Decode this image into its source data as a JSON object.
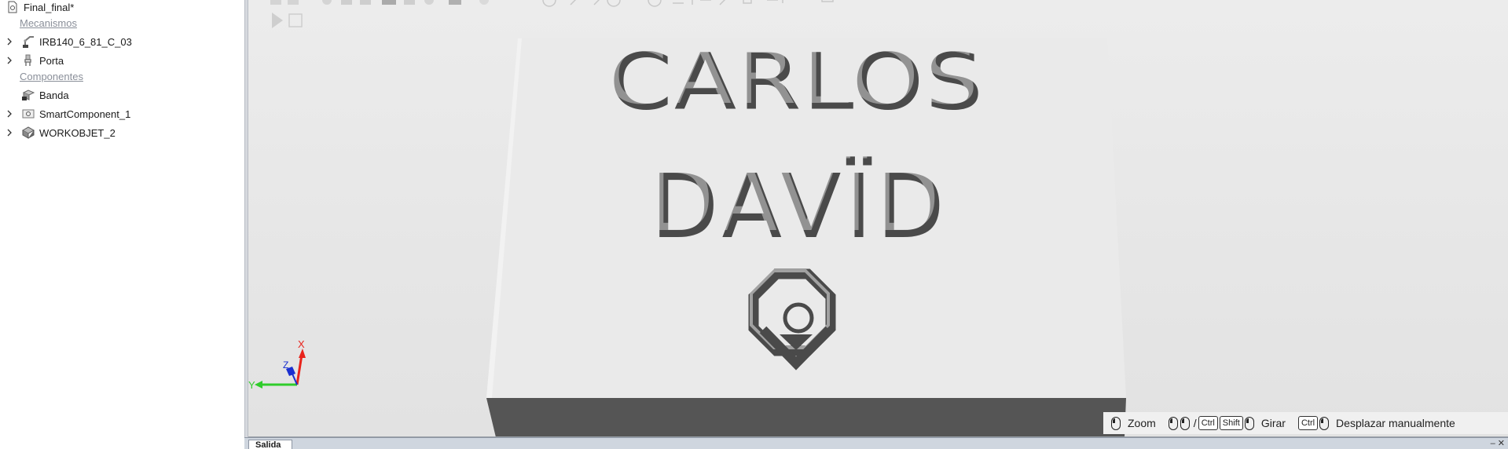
{
  "tree": {
    "station": "Final_final*",
    "mechanisms_header": "Mecanismos",
    "mechanisms": [
      {
        "label": "IRB140_6_81_C_03",
        "icon": "robot-icon",
        "expandable": true
      },
      {
        "label": "Porta",
        "icon": "tool-icon",
        "expandable": true
      }
    ],
    "components_header": "Componentes",
    "components": [
      {
        "label": "Banda",
        "icon": "conveyor-icon",
        "expandable": false
      },
      {
        "label": "SmartComponent_1",
        "icon": "smart-component-icon",
        "expandable": true
      },
      {
        "label": "WORKOBJET_2",
        "icon": "workobject-icon",
        "expandable": true
      }
    ]
  },
  "viewport": {
    "engraving_line1": "CARLOS",
    "engraving_line2": "DAVÏD",
    "plate_color": "#ebebeb",
    "engraving_color": "#4a4a4a",
    "axis": {
      "x": "X",
      "y": "Y",
      "z": "Z",
      "x_color": "#e8231b",
      "y_color": "#2fcc2b",
      "z_color": "#1a2fd0"
    }
  },
  "hints": {
    "zoom_label": "Zoom",
    "rotate_ctrl": "Ctrl",
    "rotate_shift": "Shift",
    "rotate_sep": "/",
    "rotate_label": "Girar",
    "pan_ctrl": "Ctrl",
    "pan_label": "Desplazar manualmente"
  },
  "output": {
    "tab_label": "Salida"
  }
}
